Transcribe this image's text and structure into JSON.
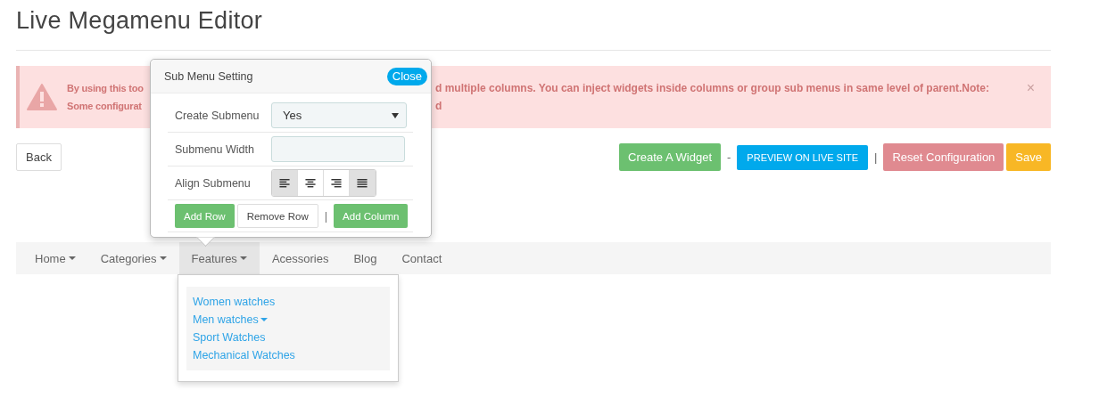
{
  "page_title": "Live Megamenu Editor",
  "alert": {
    "line_1_left": "By using this too",
    "line_1_right": "d multiple columns. You can inject widgets inside columns or group sub menus in same level of parent.Note:",
    "line_2_left": "Some configurat",
    "line_2_right": "d",
    "close": "×"
  },
  "back_button": "Back",
  "toolbar": [
    {
      "kind": "button",
      "label": "Create A Widget",
      "color": "#6cc070"
    },
    {
      "kind": "separator",
      "label": "-"
    },
    {
      "kind": "button",
      "label": "PREVIEW ON LIVE SITE",
      "color": "#00a9ec"
    },
    {
      "kind": "separator",
      "label": "|"
    },
    {
      "kind": "button",
      "label": "Reset Configuration",
      "color": "#e08a90"
    },
    {
      "kind": "button",
      "label": "Save",
      "color": "#f8b725"
    }
  ],
  "nav": [
    {
      "label": "Home",
      "caret": true,
      "selected": false
    },
    {
      "label": "Categories",
      "caret": true,
      "selected": false
    },
    {
      "label": "Features",
      "caret": true,
      "selected": true
    },
    {
      "label": "Acessories",
      "caret": false,
      "selected": false
    },
    {
      "label": "Blog",
      "caret": false,
      "selected": false
    },
    {
      "label": "Contact",
      "caret": false,
      "selected": false
    }
  ],
  "dropdown": [
    {
      "label": "Women watches",
      "caret": false
    },
    {
      "label": "Men watches",
      "caret": true
    },
    {
      "label": "Sport Watches",
      "caret": false
    },
    {
      "label": "Mechanical Watches",
      "caret": false
    }
  ],
  "popup": {
    "title": "Sub Menu Setting",
    "close": "Close",
    "create_submenu": {
      "label": "Create Submenu",
      "value": "Yes"
    },
    "submenu_width": {
      "label": "Submenu Width"
    },
    "align_submenu": {
      "label": "Align Submenu",
      "options": [
        {
          "kind": "left",
          "selected": true
        },
        {
          "kind": "center",
          "selected": false
        },
        {
          "kind": "right",
          "selected": false
        },
        {
          "kind": "justify",
          "selected": true
        }
      ]
    },
    "buttons": [
      {
        "kind": "primary",
        "label": "Add Row"
      },
      {
        "kind": "default",
        "label": "Remove Row"
      },
      {
        "kind": "separator",
        "label": "|"
      },
      {
        "kind": "primary",
        "label": "Add Column"
      }
    ]
  }
}
